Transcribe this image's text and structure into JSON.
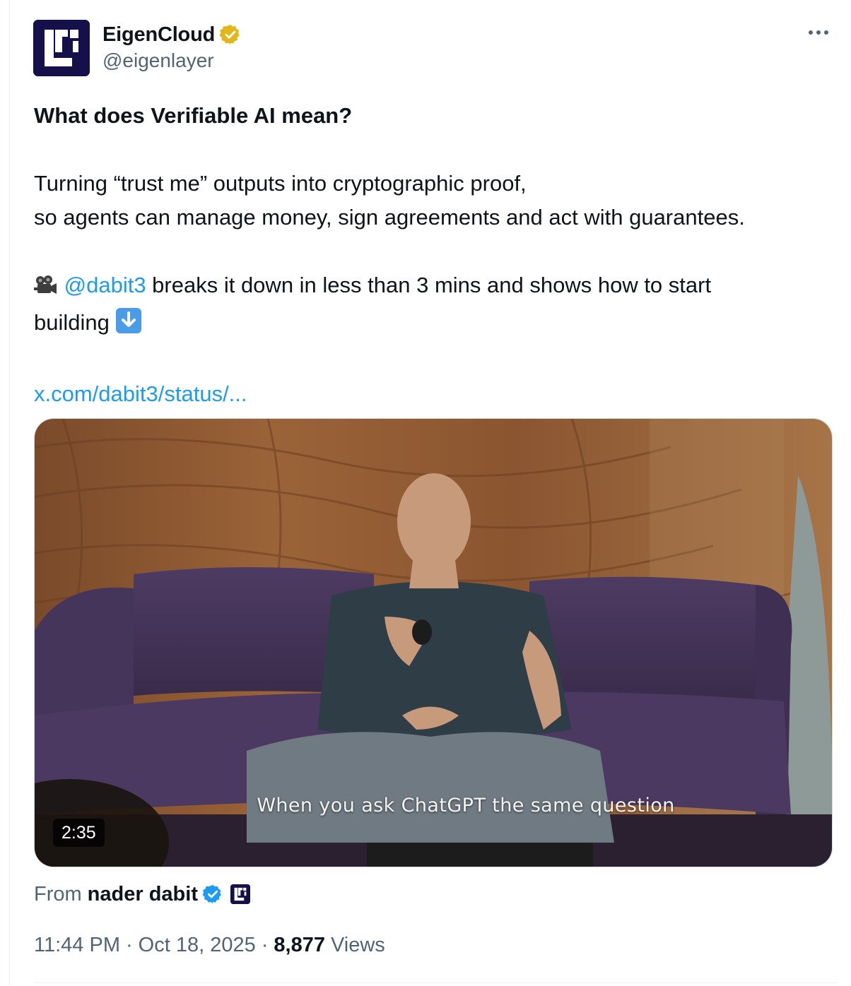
{
  "author": {
    "display_name": "EigenCloud",
    "handle": "@eigenlayer",
    "avatar_icon": "eigencloud-logo",
    "verified_badge": "gold-verified-icon"
  },
  "tweet": {
    "headline": "What does Verifiable AI mean?",
    "line1": "Turning “trust me” outputs into cryptographic proof,",
    "line2": "so agents can manage money, sign agreements and act with guarantees.",
    "camera_emoji": "🎥",
    "mention": "@dabit3",
    "line3_rest": " breaks it down in less than 3 mins and shows how to start",
    "line4": "building",
    "arrow_emoji": "⬇️",
    "link": "x.com/dabit3/status/..."
  },
  "media": {
    "caption": "When you ask ChatGPT the same question",
    "duration": "2:35"
  },
  "attribution": {
    "from_label": "From",
    "from_name": "nader dabit",
    "verified_badge": "blue-verified-icon",
    "affiliate_icon": "eigencloud-logo"
  },
  "meta": {
    "time": "11:44 PM",
    "separator": "·",
    "date": "Oct 18, 2025",
    "views_count": "8,877",
    "views_label": "Views"
  },
  "colors": {
    "link": "#1d9bf0",
    "secondary_text": "#536471",
    "verified_gold": "#e2b719",
    "verified_blue": "#1d9bf0",
    "logo_bg": "#150f4a"
  }
}
